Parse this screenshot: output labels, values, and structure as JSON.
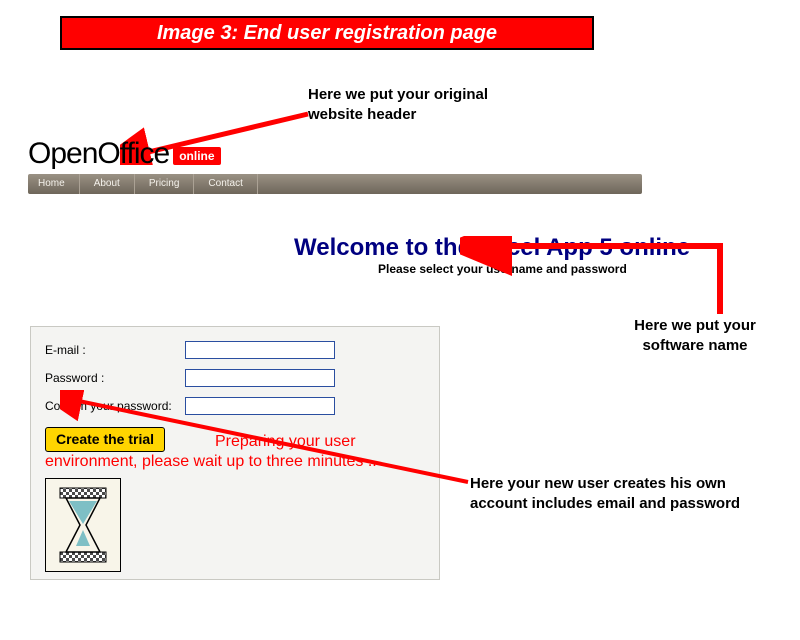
{
  "banner": {
    "title": "Image 3:  End user registration page"
  },
  "callouts": {
    "c1_l1": "Here we put your original",
    "c1_l2": "website header",
    "c2_l1": "Here we put your",
    "c2_l2": "software name",
    "c3_l1": "Here your new user creates his own",
    "c3_l2": "account includes email and password"
  },
  "logo": {
    "part_a": "OpenOffice",
    "badge": "online"
  },
  "nav": {
    "items": [
      "Home",
      "About",
      "Pricing",
      "Contact"
    ]
  },
  "page": {
    "headline": "Welcome to the Excel App 5 online",
    "subheadline": "Please select your username and password"
  },
  "form": {
    "email_label": "E-mail  :",
    "password_label": "Password  :",
    "confirm_label": "Confirm your password:",
    "button_label": "Create the trial",
    "preparing_msg": "Preparing your user environment, please wait up to three minutes .."
  }
}
